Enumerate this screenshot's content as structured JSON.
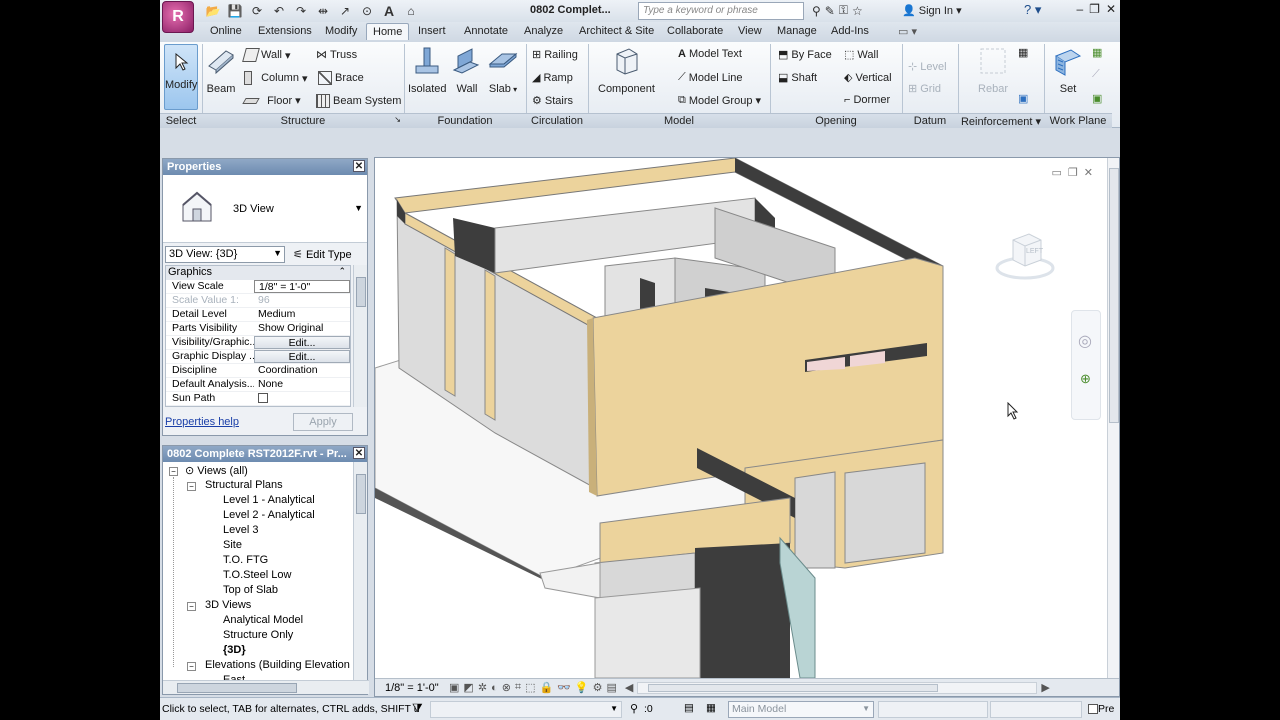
{
  "title": {
    "app_button": "R",
    "document": "0802 Complet...",
    "search_placeholder": "Type a keyword or phrase",
    "signin": "Sign In",
    "help": "?"
  },
  "tabs": [
    "Online",
    "Extensions",
    "Modify",
    "Home",
    "Insert",
    "Annotate",
    "Analyze",
    "Architect & Site",
    "Collaborate",
    "View",
    "Manage",
    "Add-Ins"
  ],
  "active_tab": "Home",
  "ribbon": {
    "select": {
      "modify": "Modify",
      "label": "Select"
    },
    "structure": {
      "beam": "Beam",
      "wall": "Wall",
      "column": "Column",
      "floor": "Floor",
      "truss": "Truss",
      "brace": "Brace",
      "beam_system": "Beam System",
      "label": "Structure"
    },
    "foundation": {
      "isolated": "Isolated",
      "wall": "Wall",
      "slab": "Slab",
      "label": "Foundation"
    },
    "circulation": {
      "railing": "Railing",
      "ramp": "Ramp",
      "stairs": "Stairs",
      "label": "Circulation"
    },
    "model": {
      "component": "Component",
      "model_text": "Model Text",
      "model_line": "Model Line",
      "model_group": "Model Group",
      "label": "Model"
    },
    "opening": {
      "by_face": "By Face",
      "shaft": "Shaft",
      "wall": "Wall",
      "vertical": "Vertical",
      "dormer": "Dormer",
      "label": "Opening"
    },
    "datum": {
      "level": "Level",
      "grid": "Grid",
      "label": "Datum"
    },
    "reinforcement": {
      "rebar": "Rebar",
      "label": "Reinforcement"
    },
    "work_plane": {
      "set": "Set",
      "label": "Work Plane"
    }
  },
  "properties": {
    "title": "Properties",
    "type_name": "3D View",
    "instance": "3D View: {3D}",
    "edit_type": "Edit Type",
    "group": "Graphics",
    "rows": [
      {
        "k": "View Scale",
        "v": "1/8\" = 1'-0\""
      },
      {
        "k": "Scale Value   1:",
        "v": "96"
      },
      {
        "k": "Detail Level",
        "v": "Medium"
      },
      {
        "k": "Parts Visibility",
        "v": "Show Original"
      },
      {
        "k": "Visibility/Graphic...",
        "v": "Edit..."
      },
      {
        "k": "Graphic Display ...",
        "v": "Edit..."
      },
      {
        "k": "Discipline",
        "v": "Coordination"
      },
      {
        "k": "Default Analysis...",
        "v": "None"
      },
      {
        "k": "Sun Path",
        "v": ""
      }
    ],
    "help": "Properties help",
    "apply": "Apply"
  },
  "browser": {
    "title": "0802 Complete RST2012F.rvt - Pr...",
    "items": [
      {
        "label": "Views (all)"
      },
      {
        "label": "Structural Plans"
      },
      {
        "label": "Level 1 - Analytical"
      },
      {
        "label": "Level 2 - Analytical"
      },
      {
        "label": "Level 3"
      },
      {
        "label": "Site"
      },
      {
        "label": "T.O. FTG"
      },
      {
        "label": "T.O.Steel Low"
      },
      {
        "label": "Top of Slab"
      },
      {
        "label": "3D Views"
      },
      {
        "label": "Analytical Model"
      },
      {
        "label": "Structure Only"
      },
      {
        "label": "{3D}"
      },
      {
        "label": "Elevations (Building Elevation"
      },
      {
        "label": "East"
      }
    ]
  },
  "viewport": {
    "scale": "1/8\" = 1'-0\"",
    "viewcube": "LEFT"
  },
  "status": {
    "message": "Click to select, TAB for alternates, CTRL adds, SHIFT u",
    "count": ":0",
    "model": "Main Model",
    "press": "Pre"
  },
  "colors": {
    "accent": "#6d8bb0",
    "wall": "#ecd39c",
    "wall_dark": "#3d3d3d"
  }
}
